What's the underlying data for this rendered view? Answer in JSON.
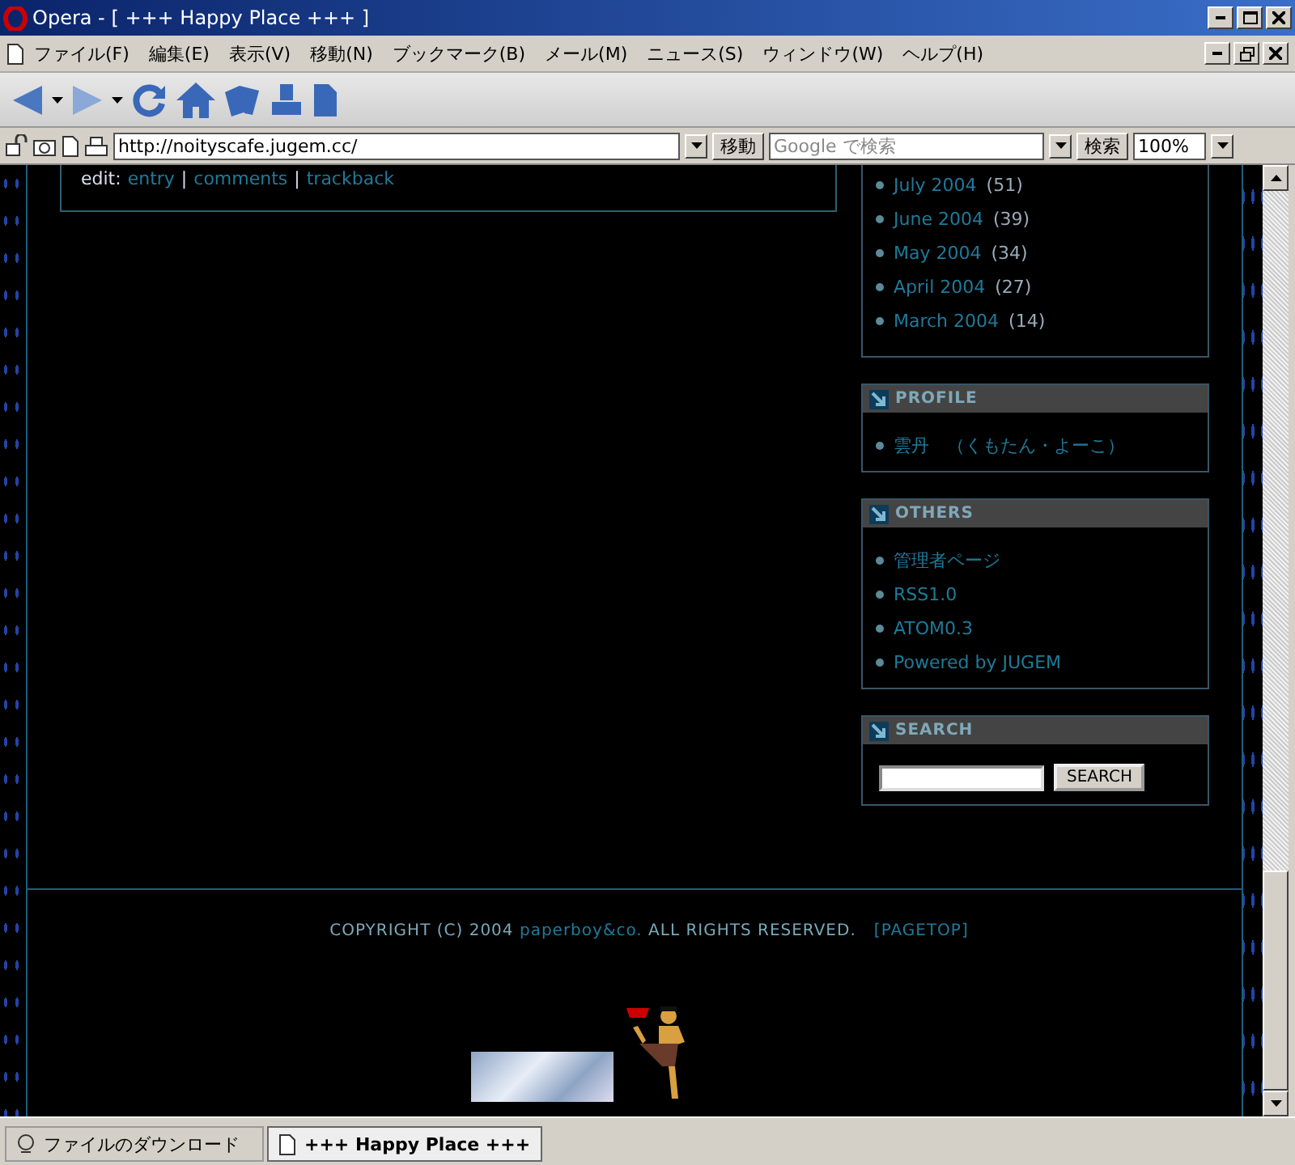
{
  "window": {
    "title": "Opera - [ +++ Happy Place +++ ]"
  },
  "menu": [
    "ファイル(F)",
    "編集(E)",
    "表示(V)",
    "移動(N)",
    "ブックマーク(B)",
    "メール(M)",
    "ニュース(S)",
    "ウィンドウ(W)",
    "ヘルプ(H)"
  ],
  "address_bar": {
    "url": "http://noityscafe.jugem.cc/",
    "go_button": "移動",
    "search_placeholder": "Google で検索",
    "search_button": "検索",
    "zoom": "100%"
  },
  "post": {
    "edit_label": "edit:",
    "separator": "|",
    "links": [
      "entry",
      "comments",
      "trackback"
    ]
  },
  "archive": [
    {
      "month": "July 2004",
      "count": "(51)"
    },
    {
      "month": "June 2004",
      "count": "(39)"
    },
    {
      "month": "May 2004",
      "count": "(34)"
    },
    {
      "month": "April 2004",
      "count": "(27)"
    },
    {
      "month": "March 2004",
      "count": "(14)"
    }
  ],
  "sidebar": [
    {
      "title": "PROFILE",
      "items": [
        "雲丹　（くもたん・よーこ）"
      ]
    },
    {
      "title": "OTHERS",
      "items": [
        "管理者ページ",
        "RSS1.0",
        "ATOM0.3",
        "Powered by JUGEM"
      ]
    }
  ],
  "search": {
    "title": "SEARCH",
    "button": "SEARCH"
  },
  "footer": {
    "before": "COPYRIGHT (C) 2004 ",
    "link": "paperboy&co.",
    "after": " ALL RIGHTS RESERVED.",
    "pagetop": "[PAGETOP]"
  },
  "tabs": [
    {
      "label": "ファイルのダウンロード",
      "selected": false,
      "kind": "download"
    },
    {
      "label": "+++ Happy Place +++",
      "selected": true,
      "kind": "page"
    }
  ]
}
